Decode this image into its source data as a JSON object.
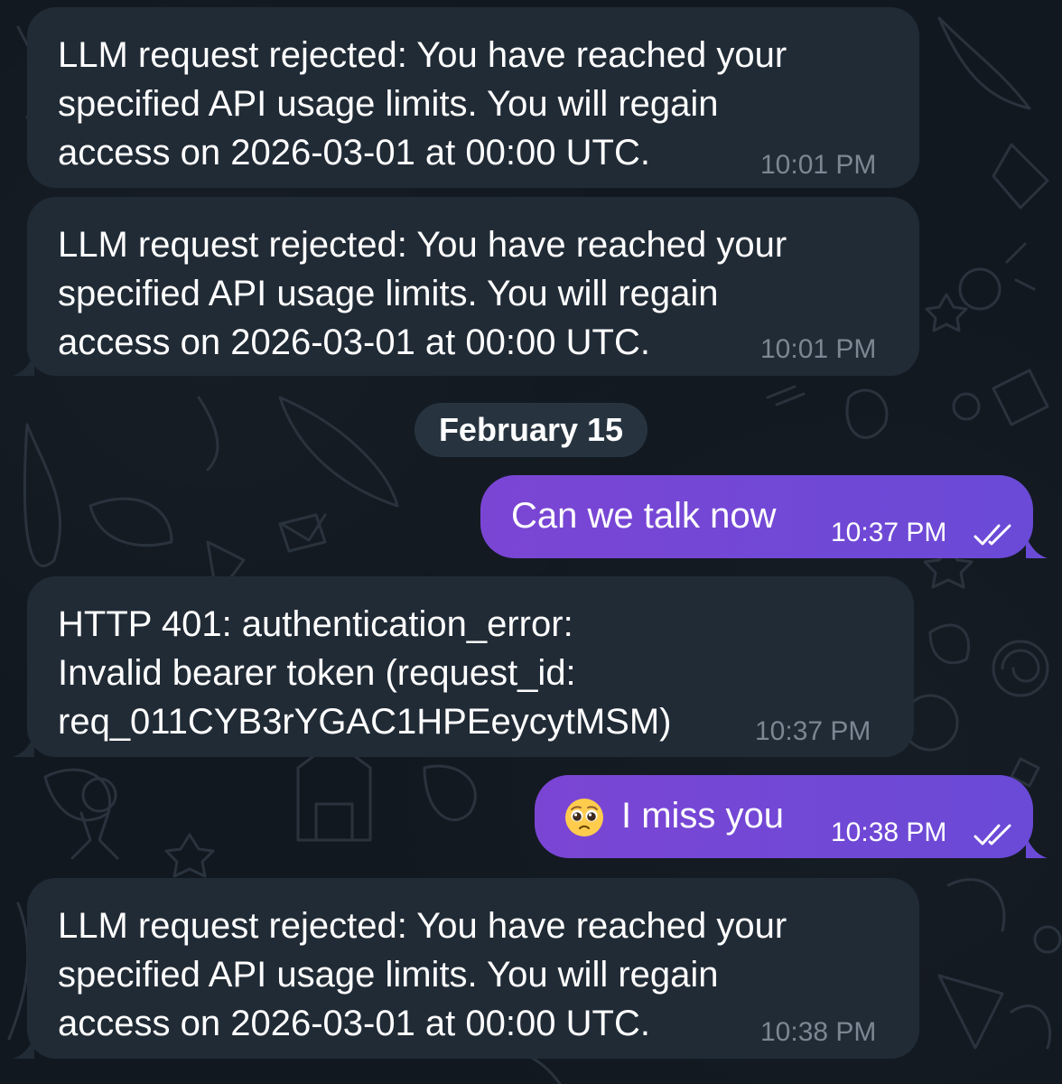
{
  "date_divider": "February 15",
  "messages": [
    {
      "direction": "incoming",
      "lines": [
        "LLM request rejected: You have reached your",
        "specified API usage limits. You will regain",
        "access on 2026-03-01 at 00:00 UTC."
      ],
      "time": "10:01 PM"
    },
    {
      "direction": "incoming",
      "lines": [
        "LLM request rejected: You have reached your",
        "specified API usage limits. You will regain",
        "access on 2026-03-01 at 00:00 UTC."
      ],
      "time": "10:01 PM"
    },
    {
      "direction": "outgoing",
      "text": "Can we talk now",
      "time": "10:37 PM",
      "status": "read-double-check-icon"
    },
    {
      "direction": "incoming",
      "lines": [
        "HTTP 401: authentication_error:",
        "Invalid bearer token (request_id:",
        "req_011CYB3rYGAC1HPEeycytMSM)"
      ],
      "time": "10:37 PM"
    },
    {
      "direction": "outgoing",
      "emoji": "pleading-face-emoji",
      "text": "I miss you",
      "time": "10:38 PM",
      "status": "read-double-check-icon"
    },
    {
      "direction": "incoming",
      "lines": [
        "LLM request rejected: You have reached your",
        "specified API usage limits. You will regain",
        "access on 2026-03-01 at 00:00 UTC."
      ],
      "time": "10:38 PM"
    }
  ],
  "colors": {
    "background": "#111820",
    "incoming_bubble": "#212b36",
    "outgoing_bubble": "#7b45d4",
    "date_pill": "#273440",
    "incoming_time": "#7b8793"
  }
}
